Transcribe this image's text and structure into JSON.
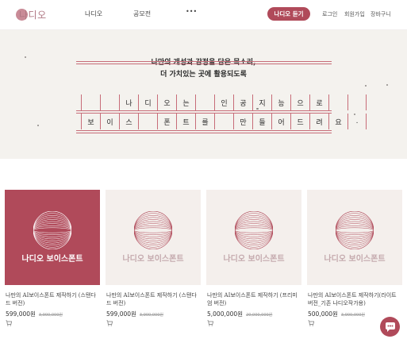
{
  "header": {
    "logo_text": "나디오",
    "nav": [
      "나디오",
      "공모전",
      "•••"
    ],
    "listen_button": "나디오 듣기",
    "links": [
      "로그인",
      "회원가입",
      "장바구니"
    ]
  },
  "hero": {
    "line1": "나만의 개성과 감정을 담은 목소리,",
    "line2": "더 가치있는 곳에 활용되도록",
    "row1": [
      "",
      "",
      "나",
      "디",
      "오",
      "는",
      "",
      "인",
      "공",
      "지",
      "능",
      "으",
      "로",
      "",
      ""
    ],
    "row2": [
      "보",
      "이",
      "스",
      "",
      "폰",
      "트",
      "를",
      "",
      "만",
      "들",
      "어",
      "드",
      "려",
      "요",
      "."
    ]
  },
  "products": [
    {
      "thumb_label": "나디오 보이스폰트",
      "name": "나만의 AI보이스폰트 제작하기 (스탠다드 버전)",
      "price": "599,000원",
      "old_price": "3,900,000원"
    },
    {
      "thumb_label": "나디오 보이스폰트",
      "name": "나만의 AI보이스폰트 제작하기 (스탠다드 버전)",
      "price": "599,000원",
      "old_price": "3,900,000원"
    },
    {
      "thumb_label": "나디오 보이스폰트",
      "name": "나만의 AI보이스폰트 제작하기 (프리미엄 버전)",
      "price": "5,000,000원",
      "old_price": "20,000,000원"
    },
    {
      "thumb_label": "나디오 보이스폰트",
      "name": "나만의 AI보이스폰트 제작하기(라이트 버전_기존 나디오작가용)",
      "price": "500,000원",
      "old_price": "3,900,000원"
    }
  ],
  "colors": {
    "brand": "#b04a5a",
    "grid": "#c76c78",
    "hero_bg": "#f4f2ee",
    "thumb_light": "#f4efec",
    "thumb_dark": "#b04a5a"
  },
  "icons": {
    "cart": "cart-icon",
    "chat": "chat-icon"
  }
}
